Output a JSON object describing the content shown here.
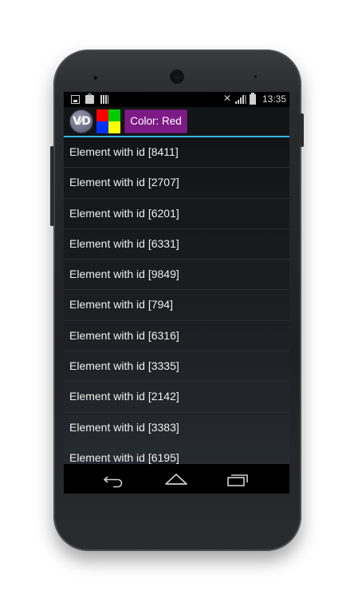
{
  "status_bar": {
    "time": "13:35",
    "icons": [
      "image-icon",
      "shopping-bag-icon",
      "barcode-icon",
      "mute-icon",
      "signal-lte-icon",
      "battery-icon"
    ]
  },
  "action_bar": {
    "logo_text": "V⁄D",
    "color_swatches": [
      "#ff0000",
      "#00cc00",
      "#0033ff",
      "#ffff00"
    ],
    "color_button_label": "Color: Red",
    "accent_color": "#33b5e5",
    "color_button_bg": "#7d1b86"
  },
  "list": {
    "items": [
      "Element with id [8411]",
      "Element with id [2707]",
      "Element with id [6201]",
      "Element with id [6331]",
      "Element with id [9849]",
      "Element with id [794]",
      "Element with id [6316]",
      "Element with id [3335]",
      "Element with id [2142]",
      "Element with id [3383]",
      "Element with id [6195]"
    ]
  },
  "nav_bar": {
    "buttons": [
      "back-icon",
      "home-icon",
      "recent-apps-icon"
    ]
  }
}
